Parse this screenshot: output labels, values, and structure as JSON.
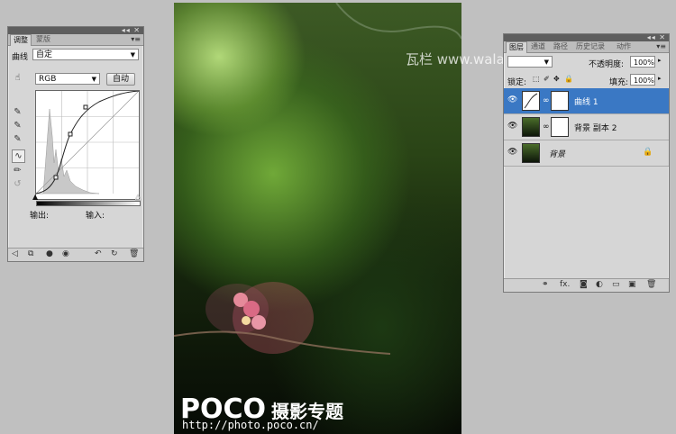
{
  "adjust_panel": {
    "tabs": [
      "调整",
      "蒙版"
    ],
    "preset_label": "曲线",
    "preset_value": "自定",
    "channel_value": "RGB",
    "auto_button": "自动",
    "output_label": "输出:",
    "input_label": "输入:"
  },
  "layers_panel": {
    "tabs": [
      "图层",
      "通道",
      "路径",
      "历史记录",
      "动作"
    ],
    "opacity_label": "不透明度:",
    "opacity_value": "100%",
    "lock_label": "锁定:",
    "fill_label": "填充:",
    "fill_value": "100%",
    "layers": [
      {
        "name": "曲线 1",
        "selected": true
      },
      {
        "name": "背景 副本 2",
        "selected": false
      },
      {
        "name": "背景",
        "selected": false
      }
    ]
  },
  "canvas": {
    "watermark": "瓦栏 www.walanwalan.com",
    "logo_main": "POCO",
    "logo_sub": "摄影专题",
    "url": "http://photo.poco.cn/"
  },
  "colors": {
    "selected_layer": "#3a78c4",
    "panel_bg": "#d6d6d6"
  }
}
